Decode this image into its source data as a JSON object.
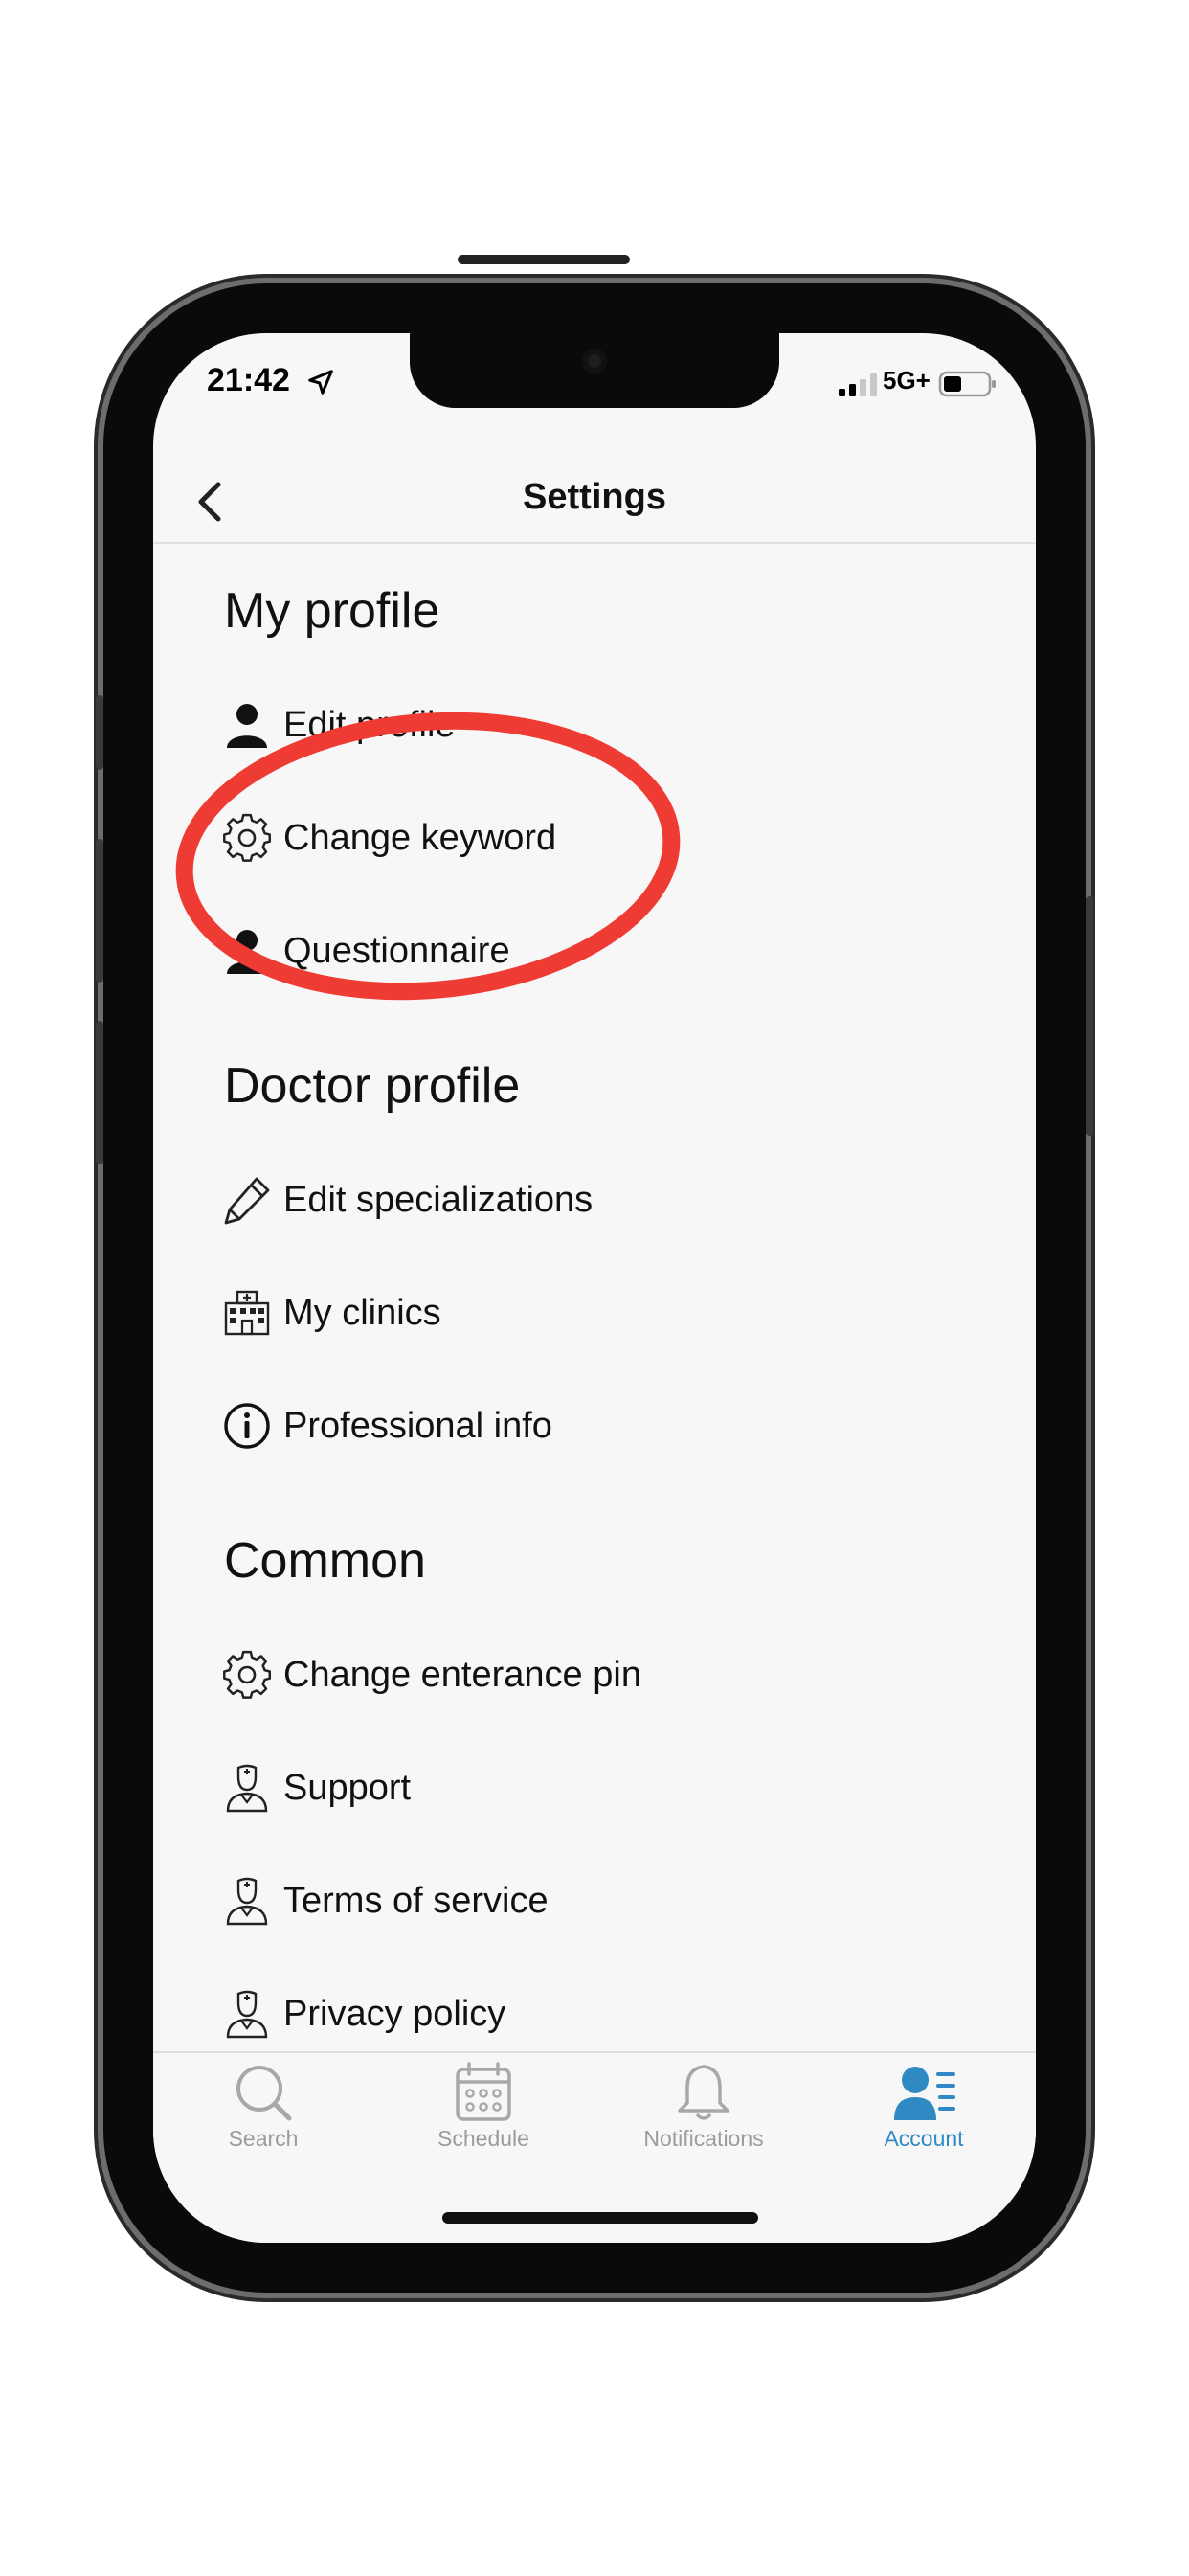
{
  "status_bar": {
    "time": "21:42",
    "network": "5G+"
  },
  "nav": {
    "title": "Settings"
  },
  "sections": [
    {
      "title": "My profile",
      "items": [
        {
          "label": "Edit profile",
          "icon": "person-icon"
        },
        {
          "label": "Change keyword",
          "icon": "gear-icon"
        },
        {
          "label": "Questionnaire",
          "icon": "person-icon"
        }
      ]
    },
    {
      "title": "Doctor profile",
      "items": [
        {
          "label": "Edit specializations",
          "icon": "pencil-icon"
        },
        {
          "label": "My clinics",
          "icon": "hospital-icon"
        },
        {
          "label": "Professional info",
          "icon": "info-icon"
        }
      ]
    },
    {
      "title": "Common",
      "items": [
        {
          "label": "Change enterance pin",
          "icon": "gear-icon"
        },
        {
          "label": "Support",
          "icon": "doctor-icon"
        },
        {
          "label": "Terms of service",
          "icon": "doctor-icon"
        },
        {
          "label": "Privacy policy",
          "icon": "doctor-icon"
        }
      ]
    }
  ],
  "tab_bar": {
    "tabs": [
      {
        "label": "Search",
        "icon": "search-icon"
      },
      {
        "label": "Schedule",
        "icon": "calendar-icon"
      },
      {
        "label": "Notifications",
        "icon": "bell-icon"
      },
      {
        "label": "Account",
        "icon": "account-icon",
        "active": true
      }
    ]
  },
  "colors": {
    "accent": "#2f8ac4",
    "tab_inactive": "#9c9c9c",
    "annotation_circle": "#ee3b33",
    "screen_background": "#f7f7f7"
  }
}
